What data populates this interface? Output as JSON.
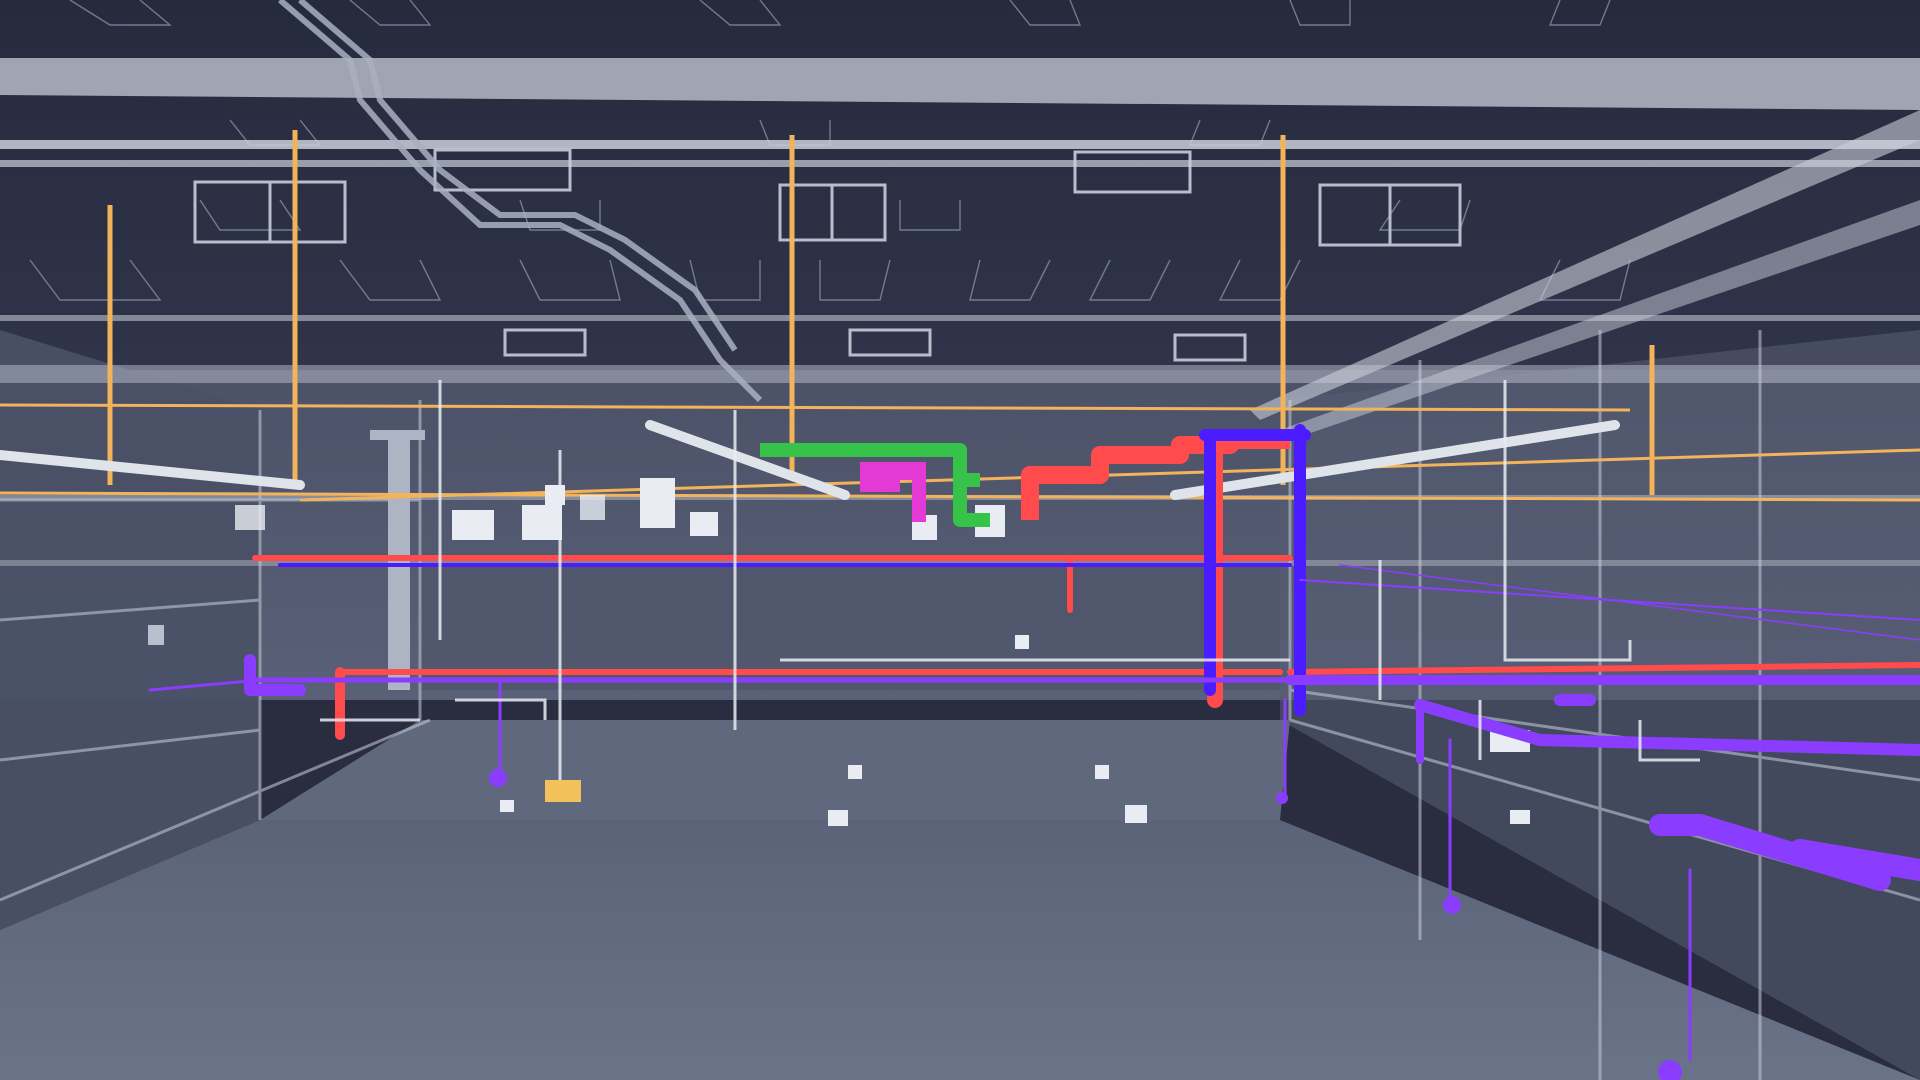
{
  "scene": {
    "kind": "bim-mep-render",
    "palette": {
      "ceiling": "#2b2e42",
      "ceiling_panel_line": "#8d93a8",
      "wall": "#5c6378",
      "floor": "#616a80",
      "frame": "#c9ced9",
      "cable_tray": "#a9b0c1",
      "hanger_orange": "#f2b35a",
      "pipe_red": "#ff4b4b",
      "pipe_blue": "#4a1cff",
      "pipe_purple": "#8a3dff",
      "duct_green": "#37c24a",
      "duct_magenta": "#e33ad6",
      "equipment_white": "#e9ecf2",
      "equipment_yellow": "#f2c15a"
    },
    "systems": [
      "ceiling-grid",
      "cable-tray",
      "hanger-rods",
      "supply-pipe",
      "return-pipe",
      "chilled-water-pipe",
      "ventilation-duct",
      "exhaust-duct",
      "light-fixtures",
      "equipment"
    ]
  }
}
